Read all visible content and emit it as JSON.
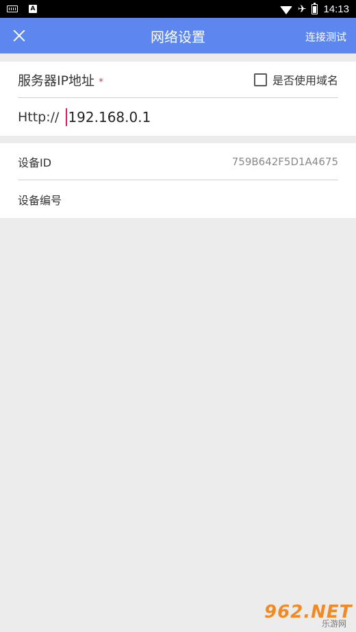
{
  "status_bar": {
    "time": "14:13"
  },
  "app_bar": {
    "title": "网络设置",
    "action_label": "连接测试"
  },
  "server": {
    "label": "服务器IP地址",
    "required_mark": "*",
    "use_domain_label": "是否使用域名",
    "use_domain_checked": false,
    "protocol_prefix": "Http://",
    "ip_value": "192.168.0.1"
  },
  "device": {
    "id_label": "设备ID",
    "id_value": "759B642F5D1A4675",
    "number_label": "设备编号",
    "number_value": ""
  },
  "watermark": {
    "brand": "962.NET",
    "sub": "乐游网"
  },
  "colors": {
    "app_bar": "#5d86ef",
    "background": "#ececec",
    "required": "#e4393c",
    "cursor": "#d81b60"
  }
}
